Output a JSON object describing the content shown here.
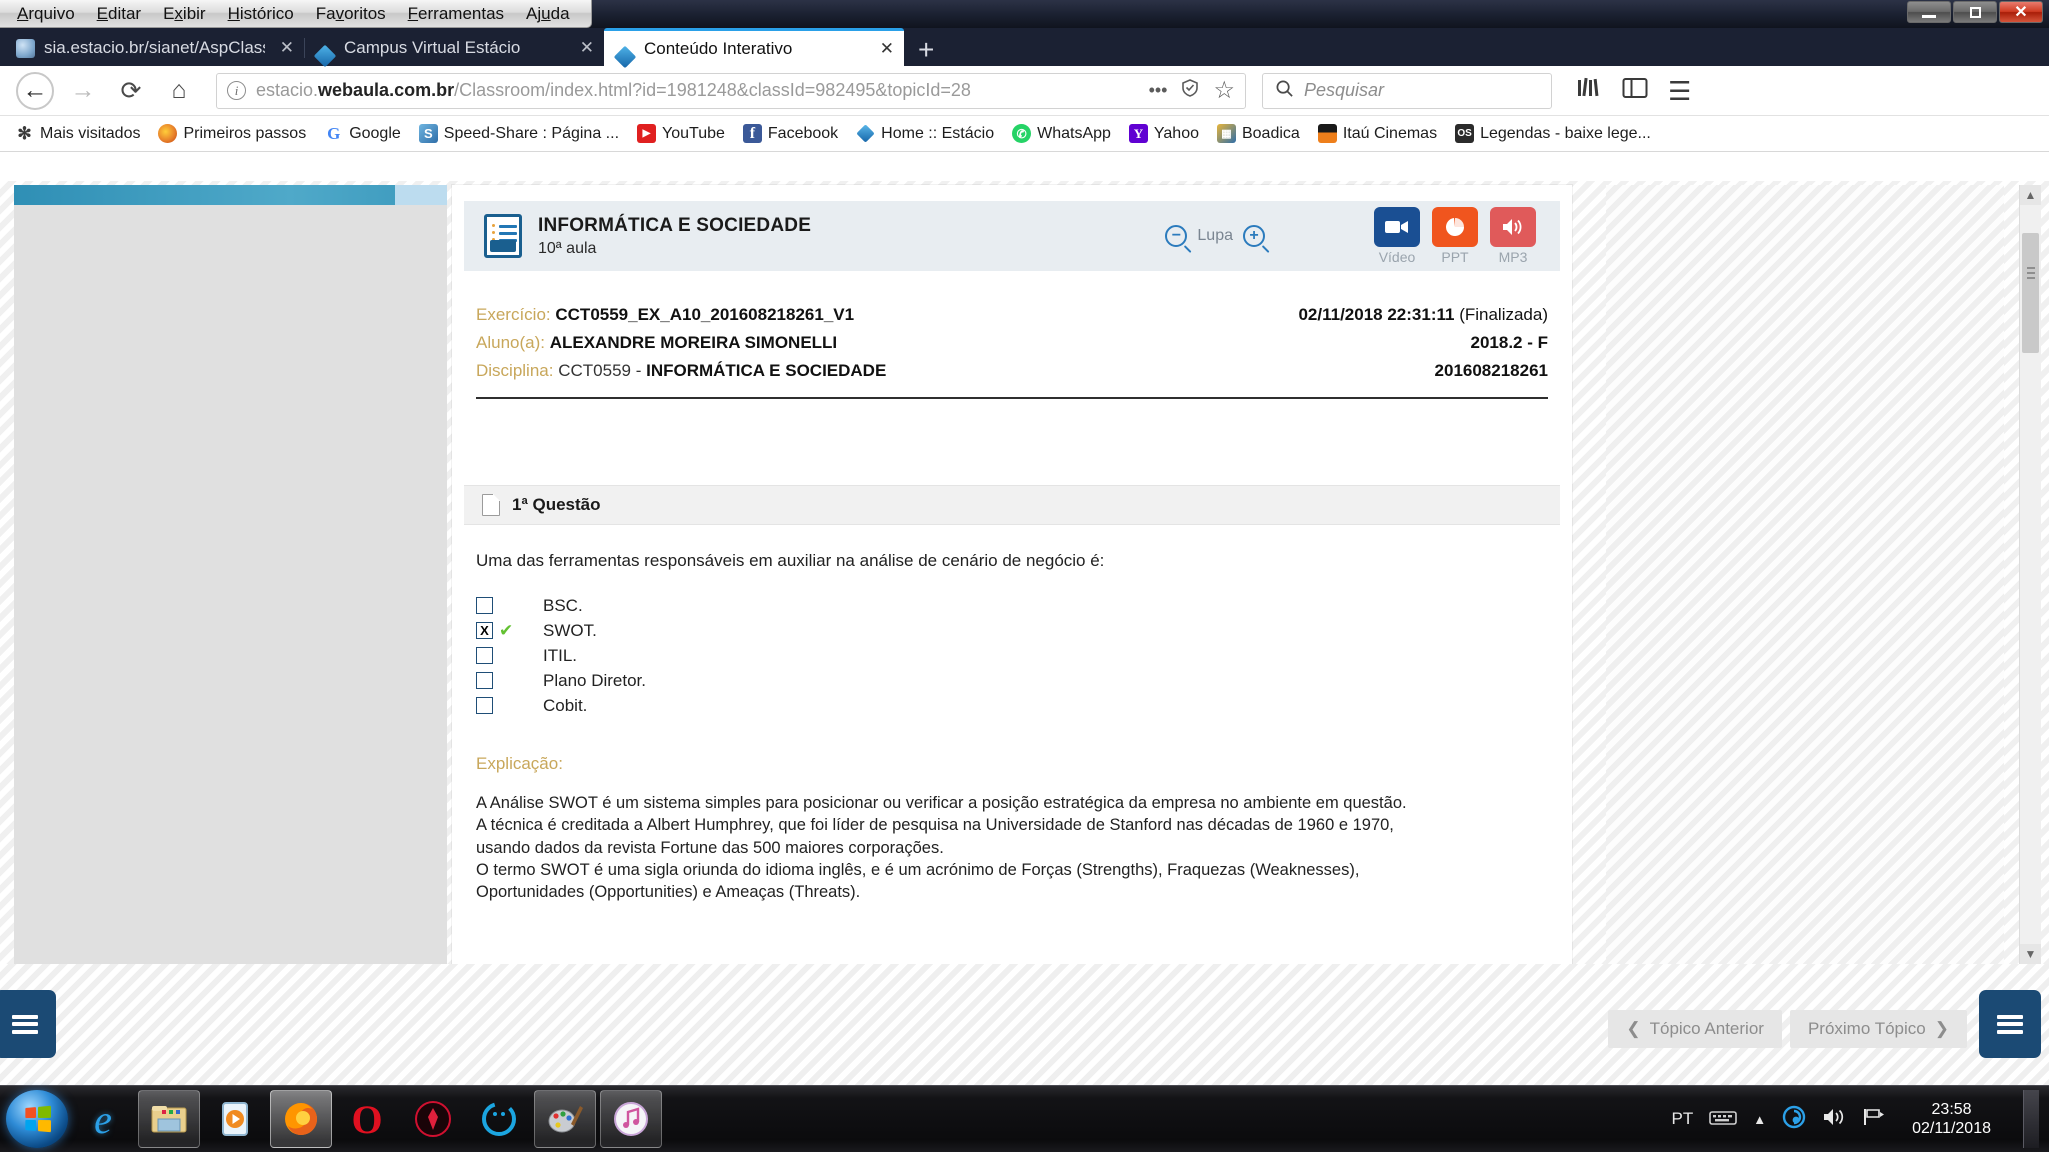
{
  "window": {
    "menus": [
      "Arquivo",
      "Editar",
      "Exibir",
      "Histórico",
      "Favoritos",
      "Ferramentas",
      "Ajuda"
    ],
    "controls": {
      "minimize": "—",
      "maximize": "❐",
      "close": "✕"
    }
  },
  "tabs": [
    {
      "label": "sia.estacio.br/sianet/AspClassic",
      "icon": "globe-favicon",
      "close": "✕",
      "active": false
    },
    {
      "label": "Campus Virtual Estácio",
      "icon": "diamond-favicon",
      "close": "✕",
      "active": false
    },
    {
      "label": "Conteúdo Interativo",
      "icon": "diamond-favicon",
      "close": "✕",
      "active": true
    }
  ],
  "newtab_label": "+",
  "navigation": {
    "back": "←",
    "forward": "→",
    "reload": "⟳",
    "home": "⌂",
    "url_prefix": "estacio.",
    "url_bold": "webaula.com.br",
    "url_rest": "/Classroom/index.html?id=1981248&classId=982495&topicId=28",
    "page_actions": "•••",
    "shield": "shield-icon",
    "bookmark_star": "☆",
    "search_placeholder": "Pesquisar",
    "library": "library-icon",
    "sidebar": "sidebar-icon",
    "menu": "☰"
  },
  "bookmarks": [
    {
      "label": "Mais visitados",
      "icon": "gear",
      "color": "#4a4a4a",
      "glyph": "✻"
    },
    {
      "label": "Primeiros passos",
      "icon": "firefox",
      "color": "#e8822b",
      "glyph": "◕"
    },
    {
      "label": "Google",
      "icon": "google",
      "color": "#ffffff",
      "glyph": "G"
    },
    {
      "label": "Speed-Share : Página ...",
      "icon": "speedshare",
      "color": "#4a90c4",
      "glyph": "S"
    },
    {
      "label": "YouTube",
      "icon": "youtube",
      "color": "#e02020",
      "glyph": "▶"
    },
    {
      "label": "Facebook",
      "icon": "facebook",
      "color": "#3b5998",
      "glyph": "f"
    },
    {
      "label": "Home :: Estácio",
      "icon": "estacio",
      "color": "#2b8fd0",
      "glyph": "◆"
    },
    {
      "label": "WhatsApp",
      "icon": "whatsapp",
      "color": "#25d366",
      "glyph": "✆"
    },
    {
      "label": "Yahoo",
      "icon": "yahoo",
      "color": "#6001d2",
      "glyph": "Y"
    },
    {
      "label": "Boadica",
      "icon": "boadica",
      "color": "#d9a02b",
      "glyph": "▦"
    },
    {
      "label": "Itaú Cinemas",
      "icon": "itau",
      "color": "#ee7f1b",
      "glyph": "▰"
    },
    {
      "label": "Legendas - baixe lege...",
      "icon": "legendas",
      "color": "#2b2b2b",
      "glyph": "⌗"
    }
  ],
  "lesson": {
    "title": "INFORMÁTICA E SOCIEDADE",
    "subtitle": "10ª aula",
    "zoom_out": "−",
    "zoom_label": "Lupa",
    "zoom_in": "+",
    "media": [
      {
        "caption": "Vídeo",
        "color": "#1a4f93",
        "glyph": "🎥"
      },
      {
        "caption": "PPT",
        "color": "#f0551e",
        "glyph": "◔"
      },
      {
        "caption": "MP3",
        "color": "#e05a5a",
        "glyph": "🔊"
      }
    ]
  },
  "info": {
    "rows": [
      {
        "key": "Exercício:",
        "value": "CCT0559_EX_A10_201608218261_V1",
        "bold": true,
        "right": "02/11/2018 22:31:11",
        "right_note": "(Finalizada)"
      },
      {
        "key": "Aluno(a):",
        "value": "ALEXANDRE MOREIRA SIMONELLI",
        "bold": true,
        "right": "2018.2 - F",
        "right_note": ""
      },
      {
        "key": "Disciplina:",
        "value_plain": "CCT0559 - ",
        "value": "INFORMÁTICA E SOCIEDADE",
        "bold": true,
        "right": "201608218261",
        "right_note": ""
      }
    ]
  },
  "question": {
    "header": "1ª Questão",
    "statement": "Uma das ferramentas responsáveis em auxiliar na análise de cenário de negócio é:",
    "options": [
      {
        "label": "BSC.",
        "checked": false,
        "correct": false
      },
      {
        "label": "SWOT.",
        "checked": true,
        "correct": true
      },
      {
        "label": "ITIL.",
        "checked": false,
        "correct": false
      },
      {
        "label": "Plano Diretor.",
        "checked": false,
        "correct": false
      },
      {
        "label": "Cobit.",
        "checked": false,
        "correct": false
      }
    ],
    "checked_mark": "X",
    "correct_mark": "✔",
    "explanation_label": "Explicação:",
    "explanation_lines": [
      "A Análise SWOT é um sistema simples para posicionar ou verificar a posição estratégica da empresa no ambiente em questão.",
      "A técnica é creditada a Albert Humphrey, que foi líder de pesquisa na Universidade de Stanford nas décadas de 1960 e 1970,",
      "usando dados da revista Fortune das 500 maiores corporações.",
      "O termo SWOT é uma sigla oriunda do idioma inglês, e é um acrónimo de Forças (Strengths), Fraquezas (Weaknesses),",
      "Oportunidades (Opportunities) e Ameaças (Threats)."
    ]
  },
  "footer": {
    "menu_left": "☰",
    "menu_right": "☰",
    "help": "?",
    "prev_label": "Tópico Anterior",
    "prev_arrow": "❮",
    "next_label": "Próximo Tópico",
    "next_arrow": "❯"
  },
  "taskbar": {
    "start": "windows-start-orb",
    "apps": [
      {
        "name": "internet-explorer",
        "glyph": "e",
        "color": "#1e90ff",
        "state": "idle"
      },
      {
        "name": "windows-explorer",
        "glyph": "🗂",
        "color": "#e8c46a",
        "state": "running"
      },
      {
        "name": "media-player",
        "glyph": "▶",
        "color": "#f08a20",
        "state": "idle"
      },
      {
        "name": "firefox",
        "glyph": "◕",
        "color": "#e8822b",
        "state": "active"
      },
      {
        "name": "opera",
        "glyph": "O",
        "color": "#e01020",
        "state": "idle"
      },
      {
        "name": "kmplayer",
        "glyph": "✪",
        "color": "#d01030",
        "state": "idle"
      },
      {
        "name": "ccleaner",
        "glyph": "C",
        "color": "#1ba5e0",
        "state": "idle"
      },
      {
        "name": "paint",
        "glyph": "🎨",
        "color": "#c0c0c0",
        "state": "running"
      },
      {
        "name": "itunes",
        "glyph": "♪",
        "color": "#e060b0",
        "state": "running"
      }
    ],
    "language": "PT",
    "keyboard_icon": "keyboard-icon",
    "show_hidden": "▲",
    "tray_icons": [
      "network-icon",
      "volume-icon",
      "action-center-flag-icon"
    ],
    "time": "23:58",
    "date": "02/11/2018"
  }
}
